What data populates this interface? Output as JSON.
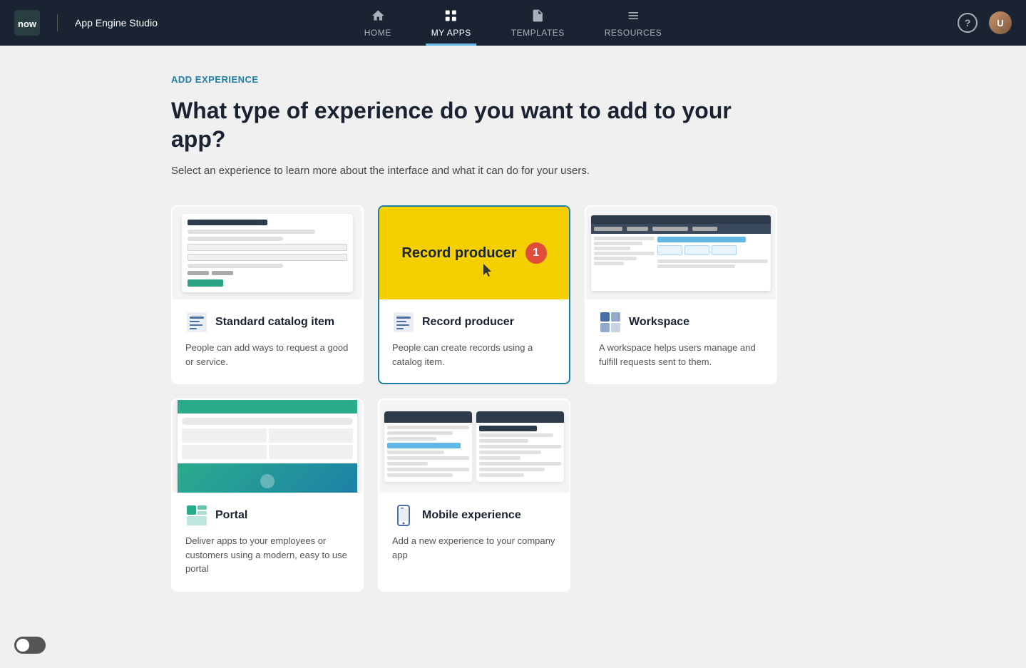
{
  "app": {
    "title": "App Engine Studio"
  },
  "nav": {
    "items": [
      {
        "id": "home",
        "label": "HOME",
        "active": false
      },
      {
        "id": "my-apps",
        "label": "MY APPS",
        "active": true
      },
      {
        "id": "templates",
        "label": "TEMPLATES",
        "active": false
      },
      {
        "id": "resources",
        "label": "RESOURCES",
        "active": false
      }
    ]
  },
  "page": {
    "breadcrumb": "ADD EXPERIENCE",
    "title": "What type of experience do you want to add to your app?",
    "subtitle": "Select an experience to learn more about the interface and what it can do for your users."
  },
  "cards": [
    {
      "id": "standard-catalog-item",
      "title": "Standard catalog item",
      "description": "People can add ways to request a good or service.",
      "selected": false
    },
    {
      "id": "record-producer",
      "title": "Record producer",
      "description": "People can create records using a catalog item.",
      "selected": true,
      "badge": "1"
    },
    {
      "id": "workspace",
      "title": "Workspace",
      "description": "A workspace helps users manage and fulfill requests sent to them.",
      "selected": false
    },
    {
      "id": "portal",
      "title": "Portal",
      "description": "Deliver apps to your employees or customers using a modern, easy to use portal",
      "selected": false
    },
    {
      "id": "mobile-experience",
      "title": "Mobile experience",
      "description": "Add a new experience to your company app",
      "selected": false
    }
  ]
}
